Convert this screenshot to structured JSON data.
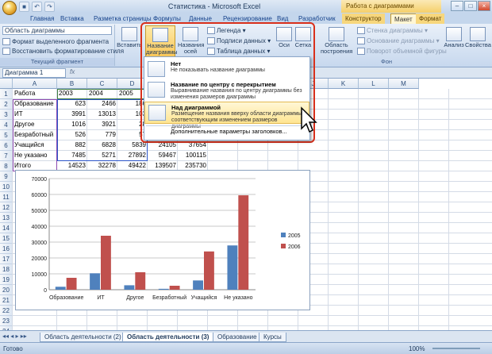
{
  "window": {
    "title": "Статистика - Microsoft Excel",
    "context_title": "Работа с диаграммами"
  },
  "tabs": [
    "Главная",
    "Вставка",
    "Разметка страницы",
    "Формулы",
    "Данные",
    "Рецензирование",
    "Вид",
    "Разработчик",
    "Конструктор",
    "Макет",
    "Формат"
  ],
  "ribbon": {
    "current_fragment": {
      "selector": "Область диаграммы",
      "format_btn": "Формат выделенного фрагмента",
      "reset_btn": "Восстановить форматирование стиля",
      "label": "Текущий фрагмент"
    },
    "insert_label": "Вставить",
    "chart_title_btn": "Название диаграммы",
    "axis_titles_btn": "Названия осей",
    "legend": "Легенда",
    "data_labels": "Подписи данных",
    "data_table": "Таблица данных",
    "axes_btn": "Оси",
    "grid_btn": "Сетка",
    "plot_area_btn": "Область построения",
    "chart_wall": "Стенка диаграммы",
    "chart_floor": "Основание диаграммы",
    "rotation_3d": "Поворот объемной фигуры",
    "bg_label": "Фон",
    "analysis_btn": "Анализ",
    "properties_btn": "Свойства"
  },
  "formula_bar": {
    "name_box": "Диаграмма 1",
    "fx": "fx"
  },
  "columns": [
    "A",
    "B",
    "C",
    "D",
    "E",
    "F",
    "G",
    "H",
    "I",
    "J",
    "K",
    "L",
    "M"
  ],
  "rows": [
    [
      "Работа",
      "2003",
      "2004",
      "2005",
      "",
      "",
      ""
    ],
    [
      "Образование",
      "623",
      "2466",
      "186",
      "",
      "",
      ""
    ],
    [
      "ИТ",
      "3991",
      "13013",
      "103",
      "",
      "",
      ""
    ],
    [
      "Другое",
      "1016",
      "3921",
      "28",
      "",
      "",
      ""
    ],
    [
      "Безработный",
      "526",
      "779",
      "57",
      "",
      "",
      ""
    ],
    [
      "Учащийся",
      "882",
      "6828",
      "5839",
      "24105",
      "37654",
      ""
    ],
    [
      "Не указано",
      "7485",
      "5271",
      "27892",
      "59467",
      "100115",
      ""
    ],
    [
      "Итого",
      "14523",
      "32278",
      "49422",
      "139507",
      "235730",
      ""
    ]
  ],
  "row_numbers": [
    "1",
    "2",
    "3",
    "4",
    "5",
    "6",
    "7",
    "8",
    "9",
    "10",
    "11",
    "12",
    "13",
    "14",
    "15",
    "16",
    "17",
    "18",
    "19",
    "20",
    "21",
    "22",
    "23",
    "24",
    "25"
  ],
  "dropdown": {
    "items": [
      {
        "title": "Нет",
        "desc": "Не показывать название диаграммы"
      },
      {
        "title": "Название по центру с перекрытием",
        "desc": "Выравнивание названия по центру диаграммы без изменения размеров диаграммы"
      },
      {
        "title": "Над диаграммой",
        "desc": "Размещение названия вверху области диаграммы с соответствующим изменением размеров диаграммы"
      }
    ],
    "more": "Дополнительные параметры заголовков..."
  },
  "chart_data": {
    "type": "bar",
    "categories": [
      "Образование",
      "ИТ",
      "Другое",
      "Безработный",
      "Учащийся",
      "Не указано"
    ],
    "series": [
      {
        "name": "2005",
        "values": [
          1860,
          10350,
          2800,
          570,
          5839,
          27892
        ],
        "color": "#4f81bd"
      },
      {
        "name": "2006",
        "values": [
          7500,
          34000,
          11000,
          2500,
          24105,
          59467
        ],
        "color": "#c0504d"
      }
    ],
    "yticks": [
      "0",
      "10000",
      "20000",
      "30000",
      "40000",
      "50000",
      "60000",
      "70000"
    ],
    "ylim": [
      0,
      70000
    ],
    "legend": "right"
  },
  "sheet_tabs": [
    "Область деятельности (2)",
    "Область деятельности (3)",
    "Образование",
    "Курсы"
  ],
  "status": {
    "ready": "Готово",
    "zoom": "100%"
  }
}
